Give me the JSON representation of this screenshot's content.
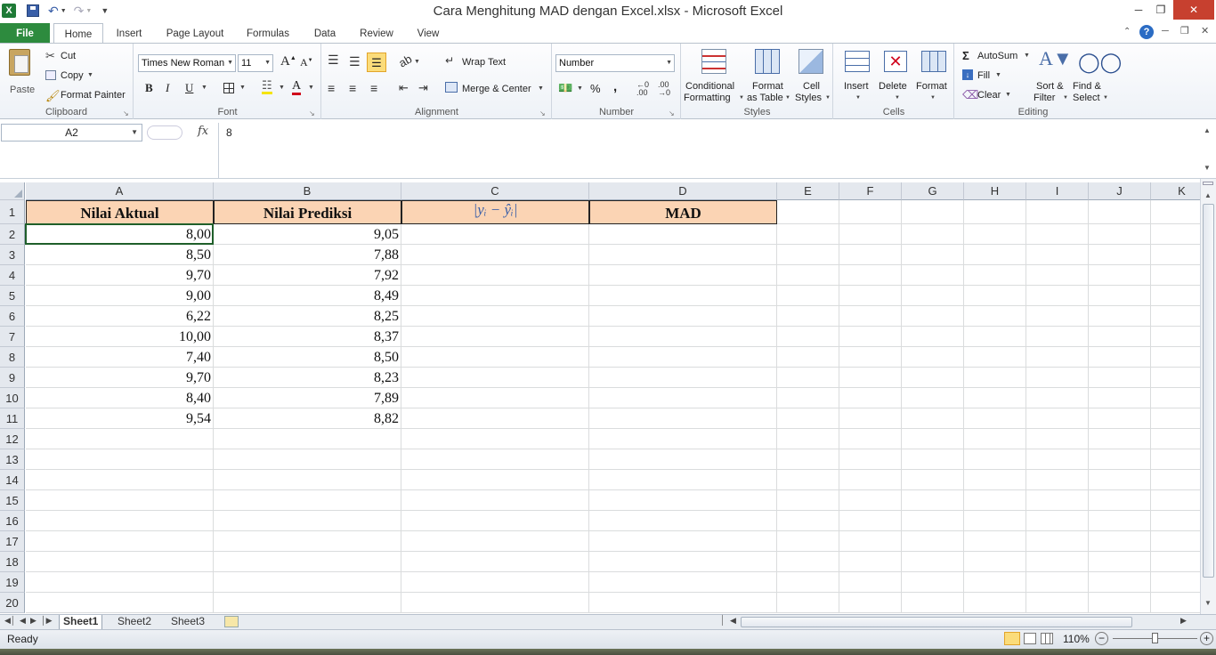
{
  "window": {
    "title": "Cara Menghitung MAD dengan Excel.xlsx - Microsoft Excel"
  },
  "tabs": [
    "File",
    "Home",
    "Insert",
    "Page Layout",
    "Formulas",
    "Data",
    "Review",
    "View"
  ],
  "ribbon": {
    "clipboard": {
      "label": "Clipboard",
      "paste": "Paste",
      "cut": "Cut",
      "copy": "Copy",
      "format_painter": "Format Painter"
    },
    "font": {
      "label": "Font",
      "family": "Times New Roman",
      "size": "11",
      "bold": "B",
      "italic": "I",
      "underline": "U",
      "font_color_glyph": "A"
    },
    "alignment": {
      "label": "Alignment",
      "wrap_text": "Wrap Text",
      "merge_center": "Merge & Center"
    },
    "number": {
      "label": "Number",
      "format": "Number",
      "percent": "%",
      "comma": ",",
      "inc_decimal": "←.0\n.00",
      "dec_decimal": ".00\n→.0"
    },
    "styles": {
      "label": "Styles",
      "conditional": "Conditional",
      "formatting": "Formatting",
      "format_as": "Format",
      "as_table": "as Table",
      "cell": "Cell",
      "styles_btn": "Styles"
    },
    "cells": {
      "label": "Cells",
      "insert": "Insert",
      "delete": "Delete",
      "format": "Format"
    },
    "editing": {
      "label": "Editing",
      "autosum": "AutoSum",
      "fill": "Fill",
      "clear": "Clear",
      "sort": "Sort &",
      "filter": "Filter",
      "find": "Find &",
      "select": "Select"
    }
  },
  "formula_bar": {
    "name_box": "A2",
    "fx": "fx",
    "value": "8"
  },
  "columns": [
    "A",
    "B",
    "C",
    "D",
    "E",
    "F",
    "G",
    "H",
    "I",
    "J",
    "K"
  ],
  "rows": [
    "1",
    "2",
    "3",
    "4",
    "5",
    "6",
    "7",
    "8",
    "9",
    "10",
    "11",
    "12",
    "13",
    "14",
    "15",
    "16",
    "17",
    "18",
    "19",
    "20"
  ],
  "table": {
    "headers": [
      "Nilai Aktual",
      "Nilai Prediksi",
      "|yᵢ − ŷᵢ|",
      "MAD"
    ],
    "actual": [
      "8,00",
      "8,50",
      "9,70",
      "9,00",
      "6,22",
      "10,00",
      "7,40",
      "9,70",
      "8,40",
      "9,54"
    ],
    "predicted": [
      "9,05",
      "7,88",
      "7,92",
      "8,49",
      "8,25",
      "8,37",
      "8,50",
      "8,23",
      "7,89",
      "8,82"
    ]
  },
  "sheets": [
    "Sheet1",
    "Sheet2",
    "Sheet3"
  ],
  "status": {
    "ready": "Ready",
    "zoom": "110%"
  }
}
